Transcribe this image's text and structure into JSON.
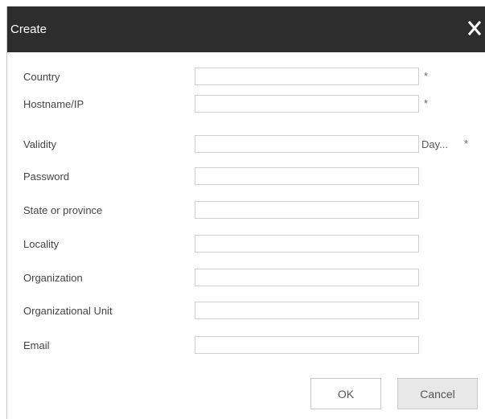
{
  "dialog": {
    "title": "Create",
    "close_icon": "close-icon"
  },
  "fields": [
    {
      "label": "Country",
      "value": "",
      "required_mark": "*"
    },
    {
      "label": "Hostname/IP",
      "value": "",
      "required_mark": "*"
    },
    {
      "label": "Validity",
      "value": "",
      "unit": "Day...",
      "required_mark": "*"
    },
    {
      "label": "Password",
      "value": ""
    },
    {
      "label": "State or province",
      "value": ""
    },
    {
      "label": "Locality",
      "value": ""
    },
    {
      "label": "Organization",
      "value": ""
    },
    {
      "label": "Organizational Unit",
      "value": ""
    },
    {
      "label": "Email",
      "value": ""
    }
  ],
  "buttons": {
    "ok_label": "OK",
    "cancel_label": "Cancel"
  },
  "colors": {
    "titlebar": "#2d2d2d",
    "cancel_bg": "#e8e8e8"
  }
}
